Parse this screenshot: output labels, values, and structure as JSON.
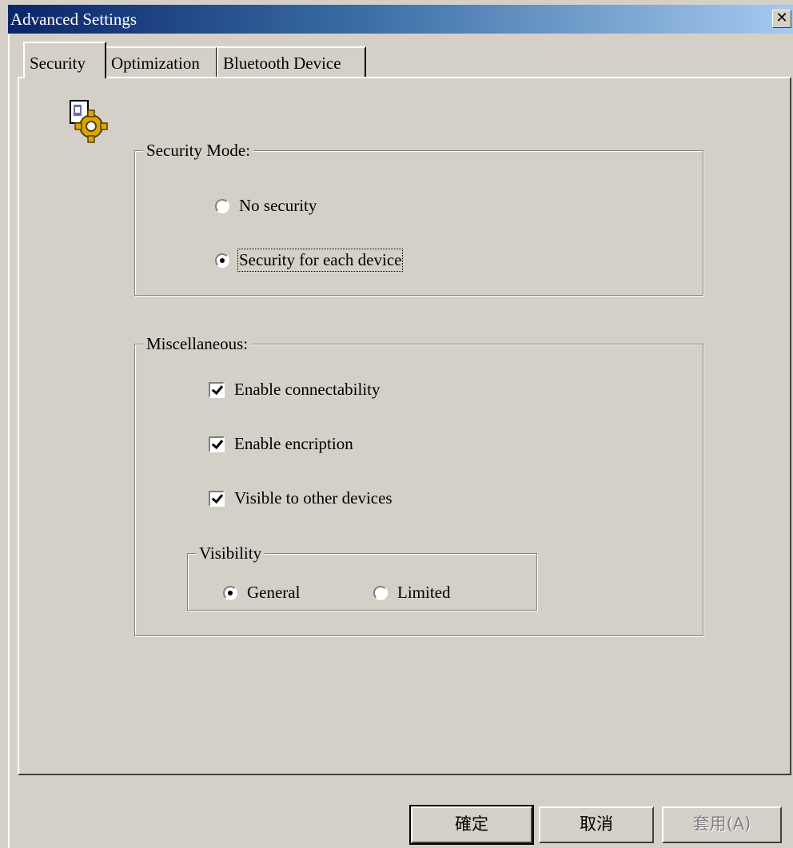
{
  "window": {
    "title": "Advanced Settings",
    "close_glyph": "✕"
  },
  "tabs": [
    {
      "label": "Security",
      "active": true
    },
    {
      "label": "Optimization",
      "active": false
    },
    {
      "label": "Bluetooth Device",
      "active": false
    }
  ],
  "app_icon": "security-settings-gear-icon",
  "security_mode": {
    "title": "Security Mode:",
    "options": [
      {
        "label": "No security",
        "checked": false
      },
      {
        "label": "Security for each device",
        "checked": true
      }
    ]
  },
  "miscellaneous": {
    "title": "Miscellaneous:",
    "checkboxes": [
      {
        "label": "Enable connectability",
        "checked": true
      },
      {
        "label": "Enable encription",
        "checked": true
      },
      {
        "label": "Visible to other devices",
        "checked": true
      }
    ],
    "visibility": {
      "title": "Visibility",
      "options": [
        {
          "label": "General",
          "checked": true
        },
        {
          "label": "Limited",
          "checked": false
        }
      ]
    }
  },
  "buttons": {
    "ok": "確定",
    "cancel": "取消",
    "apply": "套用(A)",
    "apply_enabled": false
  },
  "colors": {
    "face": "#d4d0c8",
    "title_gradient_start": "#0a246a",
    "title_gradient_end": "#a6caf0"
  }
}
